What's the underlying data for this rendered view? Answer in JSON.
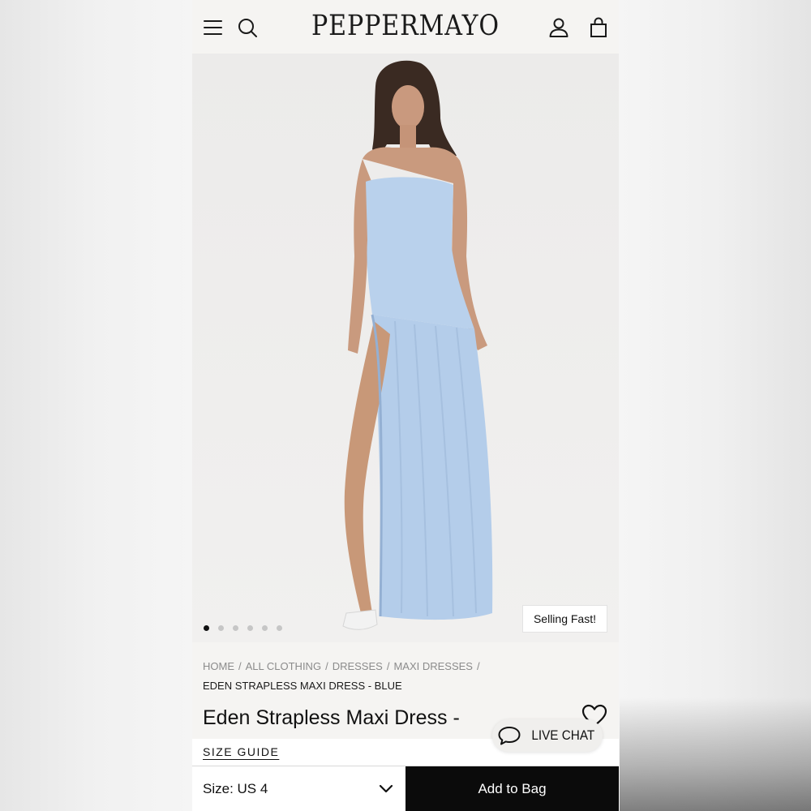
{
  "brand": {
    "logo": "PEPPERMAYO"
  },
  "header": {
    "menu_icon": "menu-icon",
    "search_icon": "search-icon",
    "account_icon": "user-icon",
    "bag_icon": "shopping-bag-icon"
  },
  "gallery": {
    "image_count": 6,
    "active_index": 0,
    "badge": "Selling Fast!",
    "dress_color": "#b9d1ec"
  },
  "breadcrumbs": {
    "items": [
      "HOME",
      "ALL CLOTHING",
      "DRESSES",
      "MAXI DRESSES"
    ],
    "separator": "/",
    "current": "EDEN STRAPLESS MAXI DRESS - BLUE"
  },
  "product": {
    "title": "Eden Strapless Maxi Dress -",
    "size_guide": "SIZE GUIDE",
    "wishlist_icon": "heart-icon"
  },
  "chat": {
    "label": "LIVE CHAT",
    "icon": "chat-bubble-icon"
  },
  "purchase": {
    "size_label": "Size: US 4",
    "add_to_bag": "Add to Bag",
    "primary_color": "#0b0b0b"
  }
}
